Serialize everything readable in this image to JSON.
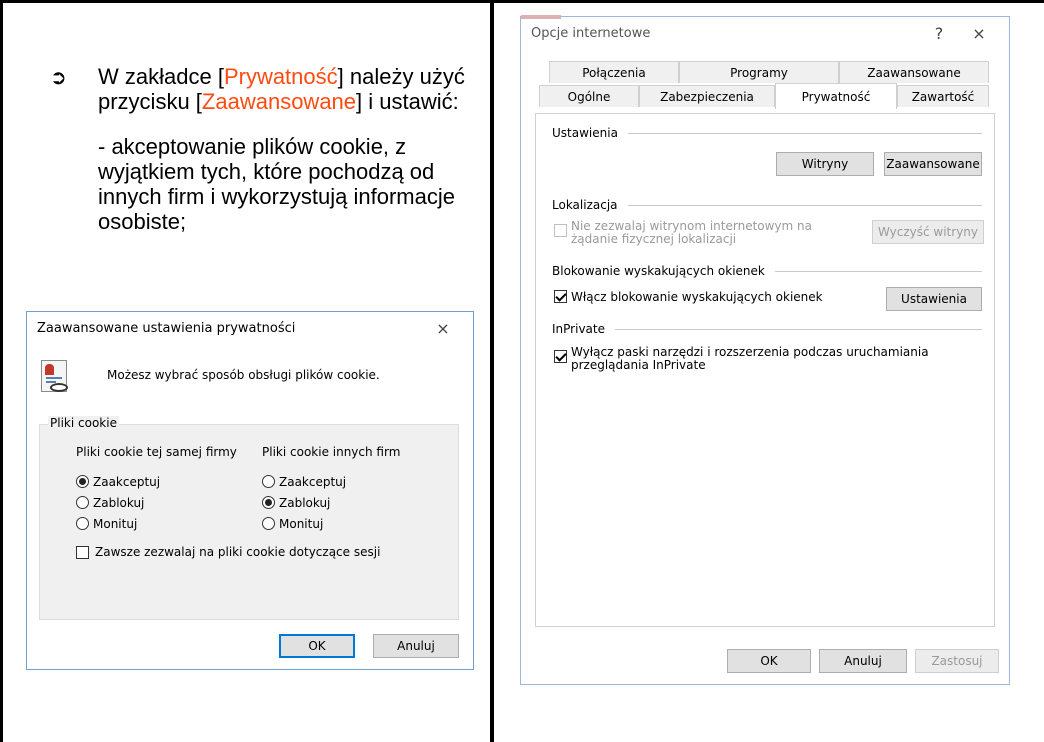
{
  "instructions": {
    "p1_a": "W zakładce [",
    "p1_b": "Prywatność",
    "p1_c": "] należy użyć przycisku [",
    "p1_d": "Zaawansowane",
    "p1_e": "] i ustawić:",
    "p2": "- akceptowanie plików cookie, z wyjątkiem tych, które pochodzą od innych firm i wykorzystują informacje osobiste;"
  },
  "privacy_dialog": {
    "title": "Zaawansowane ustawienia prywatności",
    "close": "×",
    "intro": "Możesz wybrać sposób obsługi plików cookie.",
    "group_title": "Pliki cookie",
    "first_party": {
      "header": "Pliki cookie tej samej firmy",
      "options": [
        "Zaakceptuj",
        "Zablokuj",
        "Monituj"
      ],
      "selected": "Zaakceptuj"
    },
    "third_party": {
      "header": "Pliki cookie innych firm",
      "options": [
        "Zaakceptuj",
        "Zablokuj",
        "Monituj"
      ],
      "selected": "Zablokuj"
    },
    "session_label": "Zawsze zezwalaj na pliki cookie dotyczące sesji",
    "session_checked": false,
    "ok": "OK",
    "cancel": "Anuluj"
  },
  "internet_options": {
    "title": "Opcje internetowe",
    "help": "?",
    "close": "×",
    "tabs_back": [
      "Połączenia",
      "Programy",
      "Zaawansowane"
    ],
    "tabs_front": [
      "Ogólne",
      "Zabezpieczenia",
      "Prywatność",
      "Zawartość"
    ],
    "active_tab": "Prywatność",
    "settings_section": "Ustawienia",
    "sites_button": "Witryny",
    "advanced_button": "Zaawansowane",
    "location_section": "Lokalizacja",
    "location_label_1": "Nie zezwalaj witrynom internetowym na",
    "location_label_2": "żądanie fizycznej lokalizacji",
    "clear_sites_button": "Wyczyść witryny",
    "popup_section": "Blokowanie wyskakujących okienek",
    "popup_label": "Włącz blokowanie wyskakujących okienek",
    "popup_settings_button": "Ustawienia",
    "inprivate_section": "InPrivate",
    "inprivate_label_1": "Wyłącz paski narzędzi i rozszerzenia podczas uruchamiania",
    "inprivate_label_2": "przeglądania InPrivate",
    "ok": "OK",
    "cancel": "Anuluj",
    "apply": "Zastosuj"
  }
}
